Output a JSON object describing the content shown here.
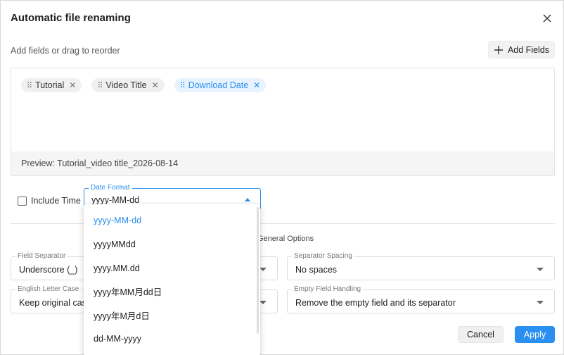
{
  "dialog": {
    "title": "Automatic file renaming",
    "subtitle": "Add fields or drag to reorder",
    "add_fields_label": "Add Fields",
    "close_icon": "close-icon",
    "add_icon": "plus-icon"
  },
  "fields": [
    {
      "label": "Tutorial",
      "active": false
    },
    {
      "label": "Video Title",
      "active": false
    },
    {
      "label": "Download Date",
      "active": true
    }
  ],
  "preview": "Preview: Tutorial_video title_2026-08-14",
  "include_time": {
    "label": "Include Time",
    "checked": false
  },
  "date_format": {
    "label": "Date Format",
    "value": "yyyy-MM-dd",
    "options": [
      "yyyy-MM-dd",
      "yyyyMMdd",
      "yyyy.MM.dd",
      "yyyy年MM月dd日",
      "yyyy年M月d日",
      "dd-MM-yyyy"
    ]
  },
  "general_options_label": "General Options",
  "field_separator": {
    "label": "Field Separator",
    "value": "Underscore (_)"
  },
  "separator_spacing": {
    "label": "Separator Spacing",
    "value": "No spaces"
  },
  "letter_case": {
    "label": "English Letter Case",
    "value": "Keep original case"
  },
  "empty_field": {
    "label": "Empty Field Handling",
    "value": "Remove the empty field and its separator"
  },
  "buttons": {
    "cancel": "Cancel",
    "apply": "Apply"
  },
  "colors": {
    "accent": "#2a8ff0",
    "chip_bg": "#f0f0f0",
    "chip_active_bg": "#e8f3ff"
  }
}
